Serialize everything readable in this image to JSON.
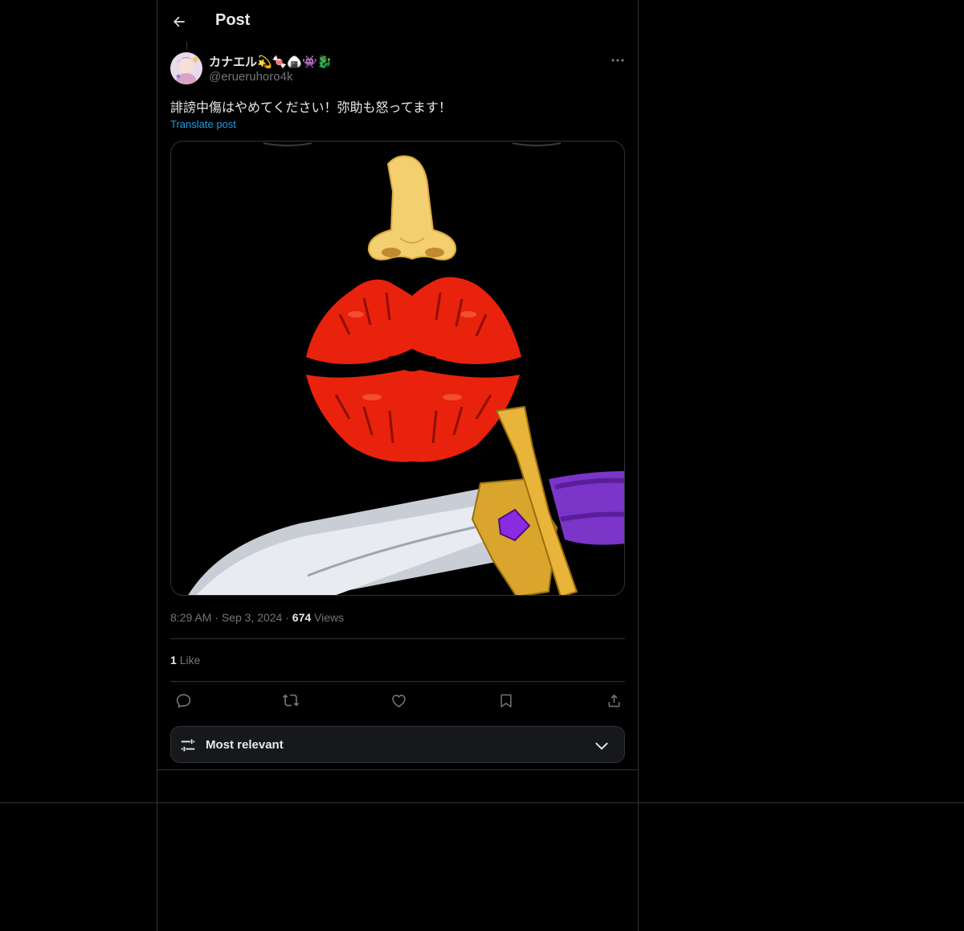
{
  "header": {
    "title": "Post",
    "back_icon": "arrow-left-icon"
  },
  "post": {
    "author": {
      "display_name": "カナエル💫🍬🍙👾🐉",
      "handle": "@erueruhoro4k"
    },
    "text": "誹謗中傷はやめてください！弥助も怒ってます！",
    "translate_label": "Translate post",
    "media_description_icons": [
      "nose-icon",
      "kiss-mark-icon",
      "dagger-icon"
    ],
    "time": "8:29 AM",
    "date": "Sep 3, 2024",
    "views_count": "674",
    "views_label": "Views",
    "likes_count": "1",
    "likes_label": "Like"
  },
  "actions": [
    "reply-icon",
    "repost-icon",
    "like-icon",
    "bookmark-icon",
    "share-icon"
  ],
  "sort": {
    "label": "Most relevant",
    "icon": "sliders-icon",
    "chevron": "chevron-down-icon"
  },
  "colors": {
    "background": "#000000",
    "text": "#e7e9ea",
    "muted": "#71767b",
    "link": "#1d9bf0",
    "border": "#2f3336"
  }
}
